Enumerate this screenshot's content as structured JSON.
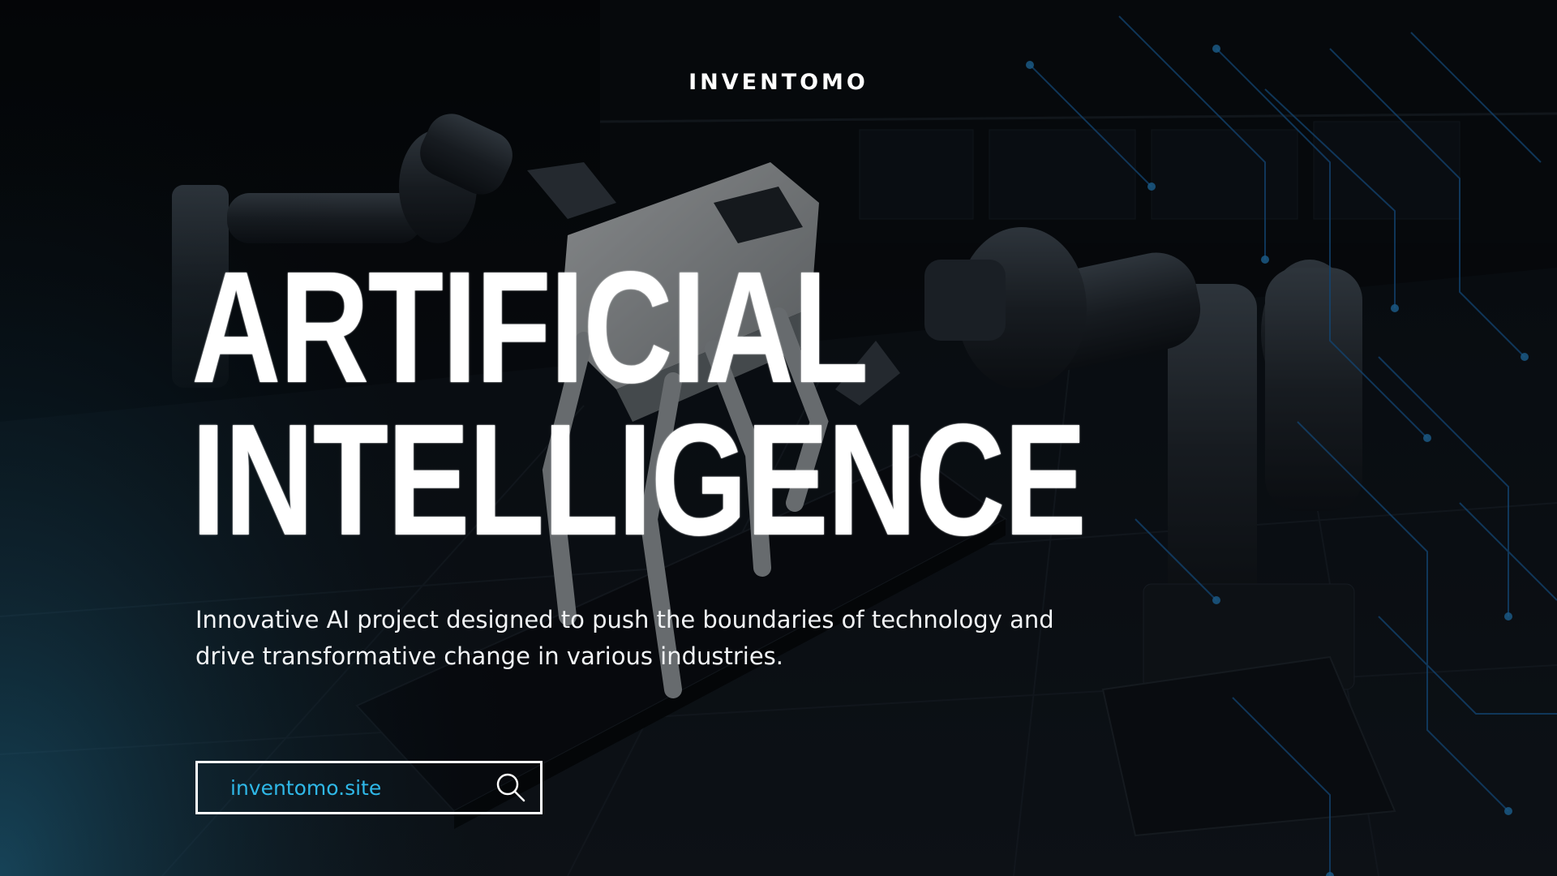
{
  "brand": {
    "name": "INVENTOMO"
  },
  "hero": {
    "title_line1": "ARTIFICIAL",
    "title_line2": "INTELLIGENCE",
    "description": "Innovative AI project designed to push the boundaries of technology and drive transformative change in various industries."
  },
  "search": {
    "value": "inventomo.site",
    "icon": "search-icon"
  },
  "colors": {
    "accent": "#2fb8e8",
    "text": "#ffffff",
    "background": "#05070a",
    "circuit": "#1e6fb8"
  }
}
